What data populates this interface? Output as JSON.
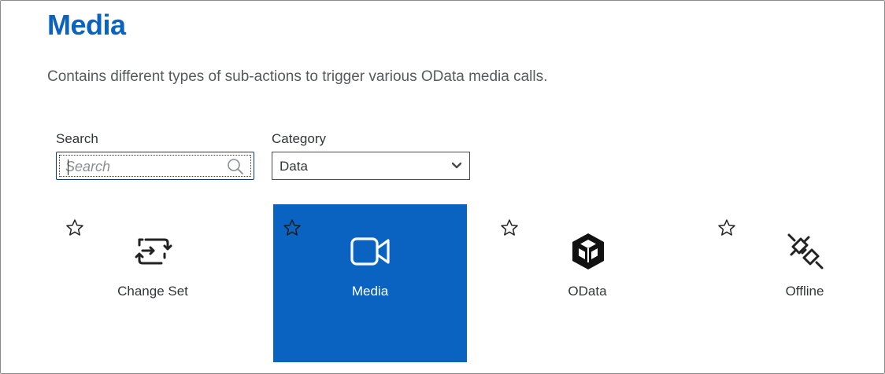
{
  "header": {
    "title": "Media",
    "description": "Contains different types of sub-actions to trigger various OData media calls."
  },
  "filters": {
    "search_label": "Search",
    "search_placeholder": "Search",
    "search_value": "",
    "category_label": "Category",
    "category_value": "Data"
  },
  "tiles": [
    {
      "label": "Change Set",
      "icon": "change-set-icon",
      "selected": false,
      "favorite": false
    },
    {
      "label": "Media",
      "icon": "video-camera-icon",
      "selected": true,
      "favorite": false
    },
    {
      "label": "OData",
      "icon": "odata-cubes-icon",
      "selected": false,
      "favorite": false
    },
    {
      "label": "Offline",
      "icon": "unplugged-icon",
      "selected": false,
      "favorite": false
    }
  ],
  "colors": {
    "accent": "#0a63c0",
    "title": "#0a63c0",
    "text": "#32363a",
    "selected_tile_bg": "#0a63c0"
  }
}
